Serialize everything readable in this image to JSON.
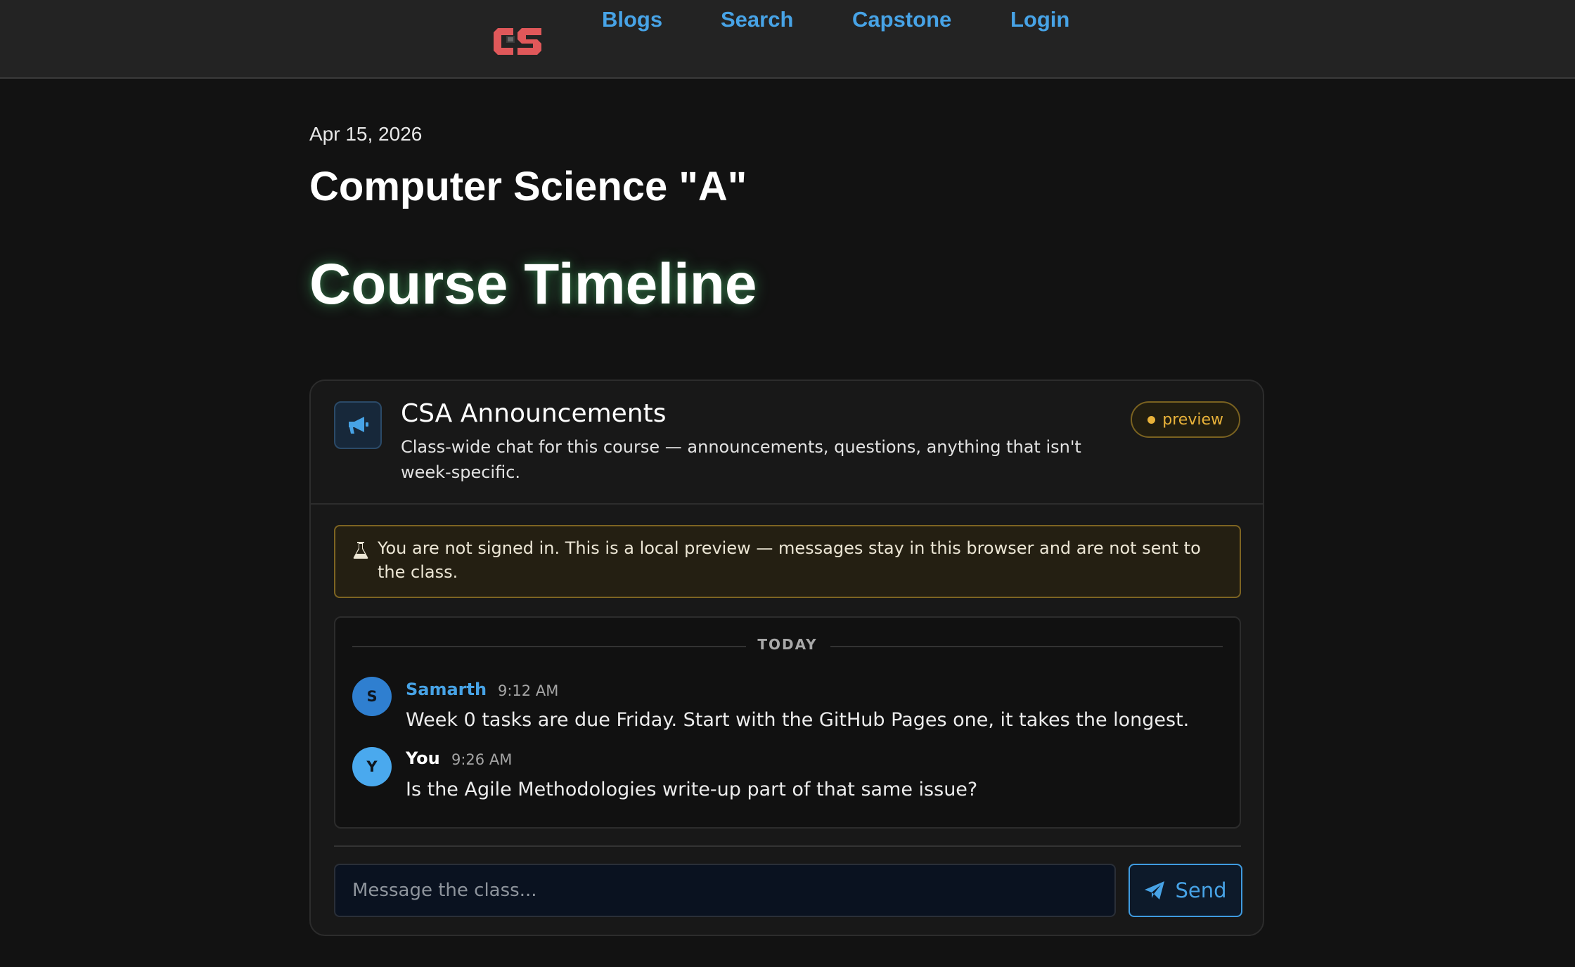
{
  "colors": {
    "background": "#121212",
    "topbar": "#232323",
    "accent_blue": "#47a3e6",
    "logo_red": "#e0585a",
    "warning_gold": "#e9b23a"
  },
  "header": {
    "logo_text": "CS",
    "nav": [
      "Blogs",
      "Search",
      "Capstone",
      "Login"
    ]
  },
  "post": {
    "date": "Apr 15, 2026",
    "course": "Computer Science \"A\"",
    "title": "Course Timeline"
  },
  "chat": {
    "icon": "megaphone-icon",
    "title": "CSA Announcements",
    "description": "Class-wide chat for this course — announcements, questions, anything that isn't week-specific.",
    "badge": "preview",
    "notice_icon": "flask-icon",
    "notice": "You are not signed in. This is a local preview — messages stay in this browser and are not sent to the class.",
    "day_divider": "TODAY",
    "messages": [
      {
        "initial": "S",
        "author": "Samarth",
        "time": "9:12 AM",
        "text": "Week 0 tasks are due Friday. Start with the GitHub Pages one, it takes the longest.",
        "author_color": "#47a3e6",
        "avatar_color": "#2f7fd0"
      },
      {
        "initial": "Y",
        "author": "You",
        "time": "9:26 AM",
        "text": "Is the Agile Methodologies write-up part of that same issue?",
        "author_color": "#ffffff",
        "avatar_color": "#4aa9ee"
      }
    ],
    "input_placeholder": "Message the class...",
    "send_label": "Send",
    "send_icon": "paper-plane-icon"
  }
}
